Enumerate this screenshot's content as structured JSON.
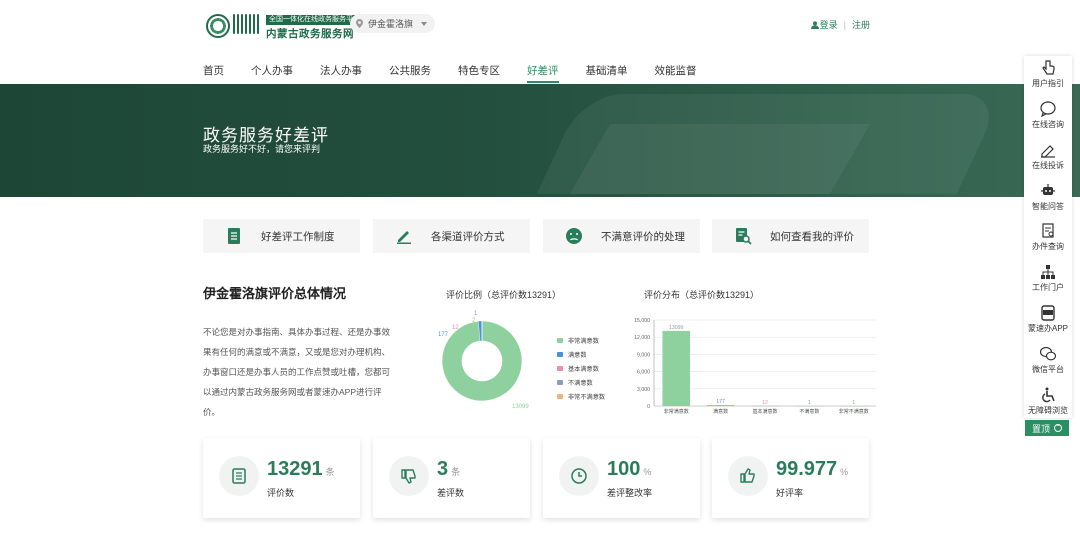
{
  "header": {
    "logo_tag": "全国一体化在线政务服务平台",
    "logo_name": "内蒙古政务服务网",
    "region": "伊金霍洛旗",
    "login": "登录",
    "register": "注册"
  },
  "nav": [
    "首页",
    "个人办事",
    "法人办事",
    "公共服务",
    "特色专区",
    "好差评",
    "基础清单",
    "效能监督"
  ],
  "nav_active": "好差评",
  "banner": {
    "title": "政务服务好差评",
    "subtitle": "政务服务好不好，请您来评判"
  },
  "tabs": [
    "好差评工作制度",
    "各渠道评价方式",
    "不满意评价的处理",
    "如何查看我的评价"
  ],
  "overview": {
    "title": "伊金霍洛旗评价总体情况",
    "text": "不论您是对办事指南、具体办事过程、还是办事效果有任何的满意或不满意，又或是您对办理机构、办事窗口还是办事人员的工作点赞或吐槽，您都可以通过内蒙古政务服务网或者蒙速办APP进行评价。"
  },
  "chart_data": [
    {
      "type": "pie",
      "title": "评价比例（总评价数13291）",
      "categories": [
        "非常满意数",
        "满意数",
        "基本满意数",
        "不满意数",
        "非常不满意数"
      ],
      "values": [
        13099,
        177,
        12,
        1,
        2
      ],
      "colors": [
        "#8fd19e",
        "#4a90e2",
        "#e88fb0",
        "#8a9cc8",
        "#f2b27a"
      ],
      "legend": "right"
    },
    {
      "type": "bar",
      "title": "评价分布（总评价数13291）",
      "categories": [
        "非常满意数",
        "满意数",
        "基本满意数",
        "不满意数",
        "非常不满意数"
      ],
      "values": [
        13099,
        177,
        12,
        1,
        1
      ],
      "ylim": [
        0,
        15000
      ],
      "yticks": [
        "0",
        "3,000",
        "6,000",
        "9,000",
        "12,000",
        "15,000"
      ],
      "grid": true,
      "color": "#8fd19e"
    }
  ],
  "stats": [
    {
      "num": "13291",
      "unit": "条",
      "label": "评价数"
    },
    {
      "num": "3",
      "unit": "条",
      "label": "差评数"
    },
    {
      "num": "100",
      "unit": "%",
      "label": "差评整改率"
    },
    {
      "num": "99.977",
      "unit": "%",
      "label": "好评率"
    }
  ],
  "sidebar": [
    "用户指引",
    "在线咨询",
    "在线投诉",
    "智能问答",
    "办件查询",
    "工作门户",
    "蒙速办APP",
    "微信平台",
    "无障碍浏览"
  ],
  "to_top": "置顶",
  "colors": {
    "brand": "#2a8f62",
    "banner": "#1d4636"
  }
}
